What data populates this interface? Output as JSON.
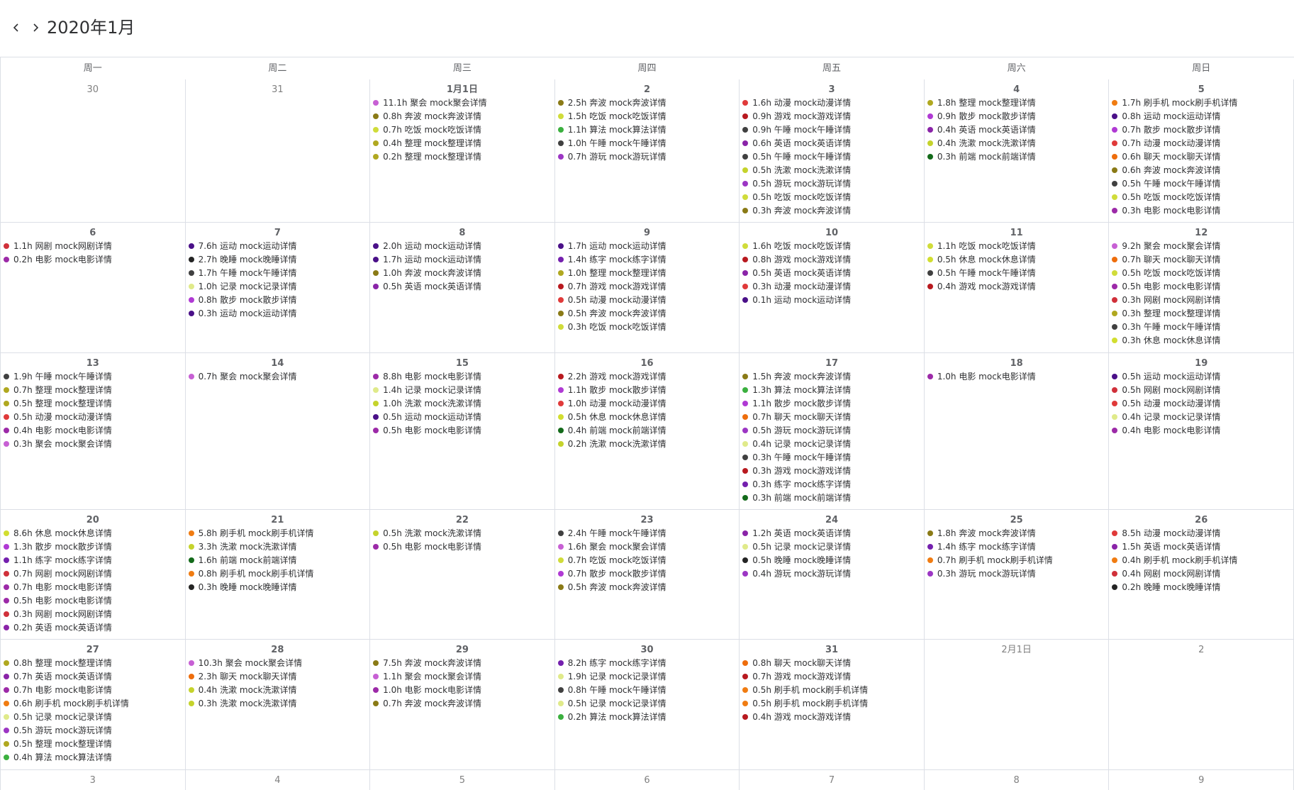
{
  "header": {
    "title": "2020年1月"
  },
  "weekdays": [
    "周一",
    "周二",
    "周三",
    "周四",
    "周五",
    "周六",
    "周日"
  ],
  "colors": {
    "动漫": "#e03a3a",
    "游戏": "#b8191f",
    "午睡": "#404040",
    "英语": "#8a24a8",
    "洗漱": "#c5d32c",
    "游玩": "#9c36c4",
    "吃饭": "#d0dc3a",
    "奔波": "#8a7a16",
    "整理": "#b0a820",
    "散步": "#b03ad4",
    "前端": "#136a1a",
    "刷手机": "#f07c12",
    "运动": "#4a1088",
    "聊天": "#ee6d0c",
    "电影": "#9c2aa8",
    "网剧": "#d0303a",
    "晚睡": "#242424",
    "记录": "#e0ea8a",
    "休息": "#d2de30",
    "聚会": "#c760d4",
    "算法": "#3bb03f",
    "练字": "#7420ae"
  },
  "cells": [
    {
      "day": "30",
      "other": true,
      "events": []
    },
    {
      "day": "31",
      "other": true,
      "events": []
    },
    {
      "day": "1月1日",
      "events": [
        {
          "text": "11.1h 聚会 mock聚会详情",
          "cat": "聚会"
        },
        {
          "text": "0.8h 奔波 mock奔波详情",
          "cat": "奔波"
        },
        {
          "text": "0.7h 吃饭 mock吃饭详情",
          "cat": "吃饭"
        },
        {
          "text": "0.4h 整理 mock整理详情",
          "cat": "整理"
        },
        {
          "text": "0.2h 整理 mock整理详情",
          "cat": "整理"
        }
      ]
    },
    {
      "day": "2",
      "events": [
        {
          "text": "2.5h 奔波 mock奔波详情",
          "cat": "奔波"
        },
        {
          "text": "1.5h 吃饭 mock吃饭详情",
          "cat": "吃饭"
        },
        {
          "text": "1.1h 算法 mock算法详情",
          "cat": "算法"
        },
        {
          "text": "1.0h 午睡 mock午睡详情",
          "cat": "午睡"
        },
        {
          "text": "0.7h 游玩 mock游玩详情",
          "cat": "游玩"
        }
      ]
    },
    {
      "day": "3",
      "events": [
        {
          "text": "1.6h 动漫 mock动漫详情",
          "cat": "动漫"
        },
        {
          "text": "0.9h 游戏 mock游戏详情",
          "cat": "游戏"
        },
        {
          "text": "0.9h 午睡 mock午睡详情",
          "cat": "午睡"
        },
        {
          "text": "0.6h 英语 mock英语详情",
          "cat": "英语"
        },
        {
          "text": "0.5h 午睡 mock午睡详情",
          "cat": "午睡"
        },
        {
          "text": "0.5h 洗漱 mock洗漱详情",
          "cat": "洗漱"
        },
        {
          "text": "0.5h 游玩 mock游玩详情",
          "cat": "游玩"
        },
        {
          "text": "0.5h 吃饭 mock吃饭详情",
          "cat": "吃饭"
        },
        {
          "text": "0.3h 奔波 mock奔波详情",
          "cat": "奔波"
        }
      ]
    },
    {
      "day": "4",
      "events": [
        {
          "text": "1.8h 整理 mock整理详情",
          "cat": "整理"
        },
        {
          "text": "0.9h 散步 mock散步详情",
          "cat": "散步"
        },
        {
          "text": "0.4h 英语 mock英语详情",
          "cat": "英语"
        },
        {
          "text": "0.4h 洗漱 mock洗漱详情",
          "cat": "洗漱"
        },
        {
          "text": "0.3h 前端 mock前端详情",
          "cat": "前端"
        }
      ]
    },
    {
      "day": "5",
      "events": [
        {
          "text": "1.7h 刷手机 mock刷手机详情",
          "cat": "刷手机"
        },
        {
          "text": "0.8h 运动 mock运动详情",
          "cat": "运动"
        },
        {
          "text": "0.7h 散步 mock散步详情",
          "cat": "散步"
        },
        {
          "text": "0.7h 动漫 mock动漫详情",
          "cat": "动漫"
        },
        {
          "text": "0.6h 聊天 mock聊天详情",
          "cat": "聊天"
        },
        {
          "text": "0.6h 奔波 mock奔波详情",
          "cat": "奔波"
        },
        {
          "text": "0.5h 午睡 mock午睡详情",
          "cat": "午睡"
        },
        {
          "text": "0.5h 吃饭 mock吃饭详情",
          "cat": "吃饭"
        },
        {
          "text": "0.3h 电影 mock电影详情",
          "cat": "电影"
        }
      ]
    },
    {
      "day": "6",
      "events": [
        {
          "text": "1.1h 网剧 mock网剧详情",
          "cat": "网剧"
        },
        {
          "text": "0.2h 电影 mock电影详情",
          "cat": "电影"
        }
      ]
    },
    {
      "day": "7",
      "events": [
        {
          "text": "7.6h 运动 mock运动详情",
          "cat": "运动"
        },
        {
          "text": "2.7h 晚睡 mock晚睡详情",
          "cat": "晚睡"
        },
        {
          "text": "1.7h 午睡 mock午睡详情",
          "cat": "午睡"
        },
        {
          "text": "1.0h 记录 mock记录详情",
          "cat": "记录"
        },
        {
          "text": "0.8h 散步 mock散步详情",
          "cat": "散步"
        },
        {
          "text": "0.3h 运动 mock运动详情",
          "cat": "运动"
        }
      ]
    },
    {
      "day": "8",
      "events": [
        {
          "text": "2.0h 运动 mock运动详情",
          "cat": "运动"
        },
        {
          "text": "1.7h 运动 mock运动详情",
          "cat": "运动"
        },
        {
          "text": "1.0h 奔波 mock奔波详情",
          "cat": "奔波"
        },
        {
          "text": "0.5h 英语 mock英语详情",
          "cat": "英语"
        }
      ]
    },
    {
      "day": "9",
      "events": [
        {
          "text": "1.7h 运动 mock运动详情",
          "cat": "运动"
        },
        {
          "text": "1.4h 练字 mock练字详情",
          "cat": "练字"
        },
        {
          "text": "1.0h 整理 mock整理详情",
          "cat": "整理"
        },
        {
          "text": "0.7h 游戏 mock游戏详情",
          "cat": "游戏"
        },
        {
          "text": "0.5h 动漫 mock动漫详情",
          "cat": "动漫"
        },
        {
          "text": "0.5h 奔波 mock奔波详情",
          "cat": "奔波"
        },
        {
          "text": "0.3h 吃饭 mock吃饭详情",
          "cat": "吃饭"
        }
      ]
    },
    {
      "day": "10",
      "events": [
        {
          "text": "1.6h 吃饭 mock吃饭详情",
          "cat": "吃饭"
        },
        {
          "text": "0.8h 游戏 mock游戏详情",
          "cat": "游戏"
        },
        {
          "text": "0.5h 英语 mock英语详情",
          "cat": "英语"
        },
        {
          "text": "0.3h 动漫 mock动漫详情",
          "cat": "动漫"
        },
        {
          "text": "0.1h 运动 mock运动详情",
          "cat": "运动"
        }
      ]
    },
    {
      "day": "11",
      "events": [
        {
          "text": "1.1h 吃饭 mock吃饭详情",
          "cat": "吃饭"
        },
        {
          "text": "0.5h 休息 mock休息详情",
          "cat": "休息"
        },
        {
          "text": "0.5h 午睡 mock午睡详情",
          "cat": "午睡"
        },
        {
          "text": "0.4h 游戏 mock游戏详情",
          "cat": "游戏"
        }
      ]
    },
    {
      "day": "12",
      "events": [
        {
          "text": "9.2h 聚会 mock聚会详情",
          "cat": "聚会"
        },
        {
          "text": "0.7h 聊天 mock聊天详情",
          "cat": "聊天"
        },
        {
          "text": "0.5h 吃饭 mock吃饭详情",
          "cat": "吃饭"
        },
        {
          "text": "0.5h 电影 mock电影详情",
          "cat": "电影"
        },
        {
          "text": "0.3h 网剧 mock网剧详情",
          "cat": "网剧"
        },
        {
          "text": "0.3h 整理 mock整理详情",
          "cat": "整理"
        },
        {
          "text": "0.3h 午睡 mock午睡详情",
          "cat": "午睡"
        },
        {
          "text": "0.3h 休息 mock休息详情",
          "cat": "休息"
        }
      ]
    },
    {
      "day": "13",
      "events": [
        {
          "text": "1.9h 午睡 mock午睡详情",
          "cat": "午睡"
        },
        {
          "text": "0.7h 整理 mock整理详情",
          "cat": "整理"
        },
        {
          "text": "0.5h 整理 mock整理详情",
          "cat": "整理"
        },
        {
          "text": "0.5h 动漫 mock动漫详情",
          "cat": "动漫"
        },
        {
          "text": "0.4h 电影 mock电影详情",
          "cat": "电影"
        },
        {
          "text": "0.3h 聚会 mock聚会详情",
          "cat": "聚会"
        }
      ]
    },
    {
      "day": "14",
      "events": [
        {
          "text": "0.7h 聚会 mock聚会详情",
          "cat": "聚会"
        }
      ]
    },
    {
      "day": "15",
      "events": [
        {
          "text": "8.8h 电影 mock电影详情",
          "cat": "电影"
        },
        {
          "text": "1.4h 记录 mock记录详情",
          "cat": "记录"
        },
        {
          "text": "1.0h 洗漱 mock洗漱详情",
          "cat": "洗漱"
        },
        {
          "text": "0.5h 运动 mock运动详情",
          "cat": "运动"
        },
        {
          "text": "0.5h 电影 mock电影详情",
          "cat": "电影"
        }
      ]
    },
    {
      "day": "16",
      "events": [
        {
          "text": "2.2h 游戏 mock游戏详情",
          "cat": "游戏"
        },
        {
          "text": "1.1h 散步 mock散步详情",
          "cat": "散步"
        },
        {
          "text": "1.0h 动漫 mock动漫详情",
          "cat": "动漫"
        },
        {
          "text": "0.5h 休息 mock休息详情",
          "cat": "休息"
        },
        {
          "text": "0.4h 前端 mock前端详情",
          "cat": "前端"
        },
        {
          "text": "0.2h 洗漱 mock洗漱详情",
          "cat": "洗漱"
        }
      ]
    },
    {
      "day": "17",
      "events": [
        {
          "text": "1.5h 奔波 mock奔波详情",
          "cat": "奔波"
        },
        {
          "text": "1.3h 算法 mock算法详情",
          "cat": "算法"
        },
        {
          "text": "1.1h 散步 mock散步详情",
          "cat": "散步"
        },
        {
          "text": "0.7h 聊天 mock聊天详情",
          "cat": "聊天"
        },
        {
          "text": "0.5h 游玩 mock游玩详情",
          "cat": "游玩"
        },
        {
          "text": "0.4h 记录 mock记录详情",
          "cat": "记录"
        },
        {
          "text": "0.3h 午睡 mock午睡详情",
          "cat": "午睡"
        },
        {
          "text": "0.3h 游戏 mock游戏详情",
          "cat": "游戏"
        },
        {
          "text": "0.3h 练字 mock练字详情",
          "cat": "练字"
        },
        {
          "text": "0.3h 前端 mock前端详情",
          "cat": "前端"
        }
      ]
    },
    {
      "day": "18",
      "events": [
        {
          "text": "1.0h 电影 mock电影详情",
          "cat": "电影"
        }
      ]
    },
    {
      "day": "19",
      "events": [
        {
          "text": "0.5h 运动 mock运动详情",
          "cat": "运动"
        },
        {
          "text": "0.5h 网剧 mock网剧详情",
          "cat": "网剧"
        },
        {
          "text": "0.5h 动漫 mock动漫详情",
          "cat": "动漫"
        },
        {
          "text": "0.4h 记录 mock记录详情",
          "cat": "记录"
        },
        {
          "text": "0.4h 电影 mock电影详情",
          "cat": "电影"
        }
      ]
    },
    {
      "day": "20",
      "events": [
        {
          "text": "8.6h 休息 mock休息详情",
          "cat": "休息"
        },
        {
          "text": "1.3h 散步 mock散步详情",
          "cat": "散步"
        },
        {
          "text": "1.1h 练字 mock练字详情",
          "cat": "练字"
        },
        {
          "text": "0.7h 网剧 mock网剧详情",
          "cat": "网剧"
        },
        {
          "text": "0.7h 电影 mock电影详情",
          "cat": "电影"
        },
        {
          "text": "0.5h 电影 mock电影详情",
          "cat": "电影"
        },
        {
          "text": "0.3h 网剧 mock网剧详情",
          "cat": "网剧"
        },
        {
          "text": "0.2h 英语 mock英语详情",
          "cat": "英语"
        }
      ]
    },
    {
      "day": "21",
      "events": [
        {
          "text": "5.8h 刷手机 mock刷手机详情",
          "cat": "刷手机"
        },
        {
          "text": "3.3h 洗漱 mock洗漱详情",
          "cat": "洗漱"
        },
        {
          "text": "1.6h 前端 mock前端详情",
          "cat": "前端"
        },
        {
          "text": "0.8h 刷手机 mock刷手机详情",
          "cat": "刷手机"
        },
        {
          "text": "0.3h 晚睡 mock晚睡详情",
          "cat": "晚睡"
        }
      ]
    },
    {
      "day": "22",
      "events": [
        {
          "text": "0.5h 洗漱 mock洗漱详情",
          "cat": "洗漱"
        },
        {
          "text": "0.5h 电影 mock电影详情",
          "cat": "电影"
        }
      ]
    },
    {
      "day": "23",
      "events": [
        {
          "text": "2.4h 午睡 mock午睡详情",
          "cat": "午睡"
        },
        {
          "text": "1.6h 聚会 mock聚会详情",
          "cat": "聚会"
        },
        {
          "text": "0.7h 吃饭 mock吃饭详情",
          "cat": "吃饭"
        },
        {
          "text": "0.7h 散步 mock散步详情",
          "cat": "散步"
        },
        {
          "text": "0.5h 奔波 mock奔波详情",
          "cat": "奔波"
        }
      ]
    },
    {
      "day": "24",
      "events": [
        {
          "text": "1.2h 英语 mock英语详情",
          "cat": "英语"
        },
        {
          "text": "0.5h 记录 mock记录详情",
          "cat": "记录"
        },
        {
          "text": "0.5h 晚睡 mock晚睡详情",
          "cat": "晚睡"
        },
        {
          "text": "0.4h 游玩 mock游玩详情",
          "cat": "游玩"
        }
      ]
    },
    {
      "day": "25",
      "events": [
        {
          "text": "1.8h 奔波 mock奔波详情",
          "cat": "奔波"
        },
        {
          "text": "1.4h 练字 mock练字详情",
          "cat": "练字"
        },
        {
          "text": "0.7h 刷手机 mock刷手机详情",
          "cat": "刷手机"
        },
        {
          "text": "0.3h 游玩 mock游玩详情",
          "cat": "游玩"
        }
      ]
    },
    {
      "day": "26",
      "events": [
        {
          "text": "8.5h 动漫 mock动漫详情",
          "cat": "动漫"
        },
        {
          "text": "1.5h 英语 mock英语详情",
          "cat": "英语"
        },
        {
          "text": "0.4h 刷手机 mock刷手机详情",
          "cat": "刷手机"
        },
        {
          "text": "0.4h 网剧 mock网剧详情",
          "cat": "网剧"
        },
        {
          "text": "0.2h 晚睡 mock晚睡详情",
          "cat": "晚睡"
        }
      ]
    },
    {
      "day": "27",
      "events": [
        {
          "text": "0.8h 整理 mock整理详情",
          "cat": "整理"
        },
        {
          "text": "0.7h 英语 mock英语详情",
          "cat": "英语"
        },
        {
          "text": "0.7h 电影 mock电影详情",
          "cat": "电影"
        },
        {
          "text": "0.6h 刷手机 mock刷手机详情",
          "cat": "刷手机"
        },
        {
          "text": "0.5h 记录 mock记录详情",
          "cat": "记录"
        },
        {
          "text": "0.5h 游玩 mock游玩详情",
          "cat": "游玩"
        },
        {
          "text": "0.5h 整理 mock整理详情",
          "cat": "整理"
        },
        {
          "text": "0.4h 算法 mock算法详情",
          "cat": "算法"
        }
      ]
    },
    {
      "day": "28",
      "events": [
        {
          "text": "10.3h 聚会 mock聚会详情",
          "cat": "聚会"
        },
        {
          "text": "2.3h 聊天 mock聊天详情",
          "cat": "聊天"
        },
        {
          "text": "0.4h 洗漱 mock洗漱详情",
          "cat": "洗漱"
        },
        {
          "text": "0.3h 洗漱 mock洗漱详情",
          "cat": "洗漱"
        }
      ]
    },
    {
      "day": "29",
      "events": [
        {
          "text": "7.5h 奔波 mock奔波详情",
          "cat": "奔波"
        },
        {
          "text": "1.1h 聚会 mock聚会详情",
          "cat": "聚会"
        },
        {
          "text": "1.0h 电影 mock电影详情",
          "cat": "电影"
        },
        {
          "text": "0.7h 奔波 mock奔波详情",
          "cat": "奔波"
        }
      ]
    },
    {
      "day": "30",
      "events": [
        {
          "text": "8.2h 练字 mock练字详情",
          "cat": "练字"
        },
        {
          "text": "1.9h 记录 mock记录详情",
          "cat": "记录"
        },
        {
          "text": "0.8h 午睡 mock午睡详情",
          "cat": "午睡"
        },
        {
          "text": "0.5h 记录 mock记录详情",
          "cat": "记录"
        },
        {
          "text": "0.2h 算法 mock算法详情",
          "cat": "算法"
        }
      ]
    },
    {
      "day": "31",
      "events": [
        {
          "text": "0.8h 聊天 mock聊天详情",
          "cat": "聊天"
        },
        {
          "text": "0.7h 游戏 mock游戏详情",
          "cat": "游戏"
        },
        {
          "text": "0.5h 刷手机 mock刷手机详情",
          "cat": "刷手机"
        },
        {
          "text": "0.5h 刷手机 mock刷手机详情",
          "cat": "刷手机"
        },
        {
          "text": "0.4h 游戏 mock游戏详情",
          "cat": "游戏"
        }
      ]
    },
    {
      "day": "2月1日",
      "other": true,
      "events": []
    },
    {
      "day": "2",
      "other": true,
      "events": []
    },
    {
      "day": "3",
      "other": true,
      "events": []
    },
    {
      "day": "4",
      "other": true,
      "events": []
    },
    {
      "day": "5",
      "other": true,
      "events": []
    },
    {
      "day": "6",
      "other": true,
      "events": []
    },
    {
      "day": "7",
      "other": true,
      "events": []
    },
    {
      "day": "8",
      "other": true,
      "events": []
    },
    {
      "day": "9",
      "other": true,
      "events": []
    }
  ]
}
